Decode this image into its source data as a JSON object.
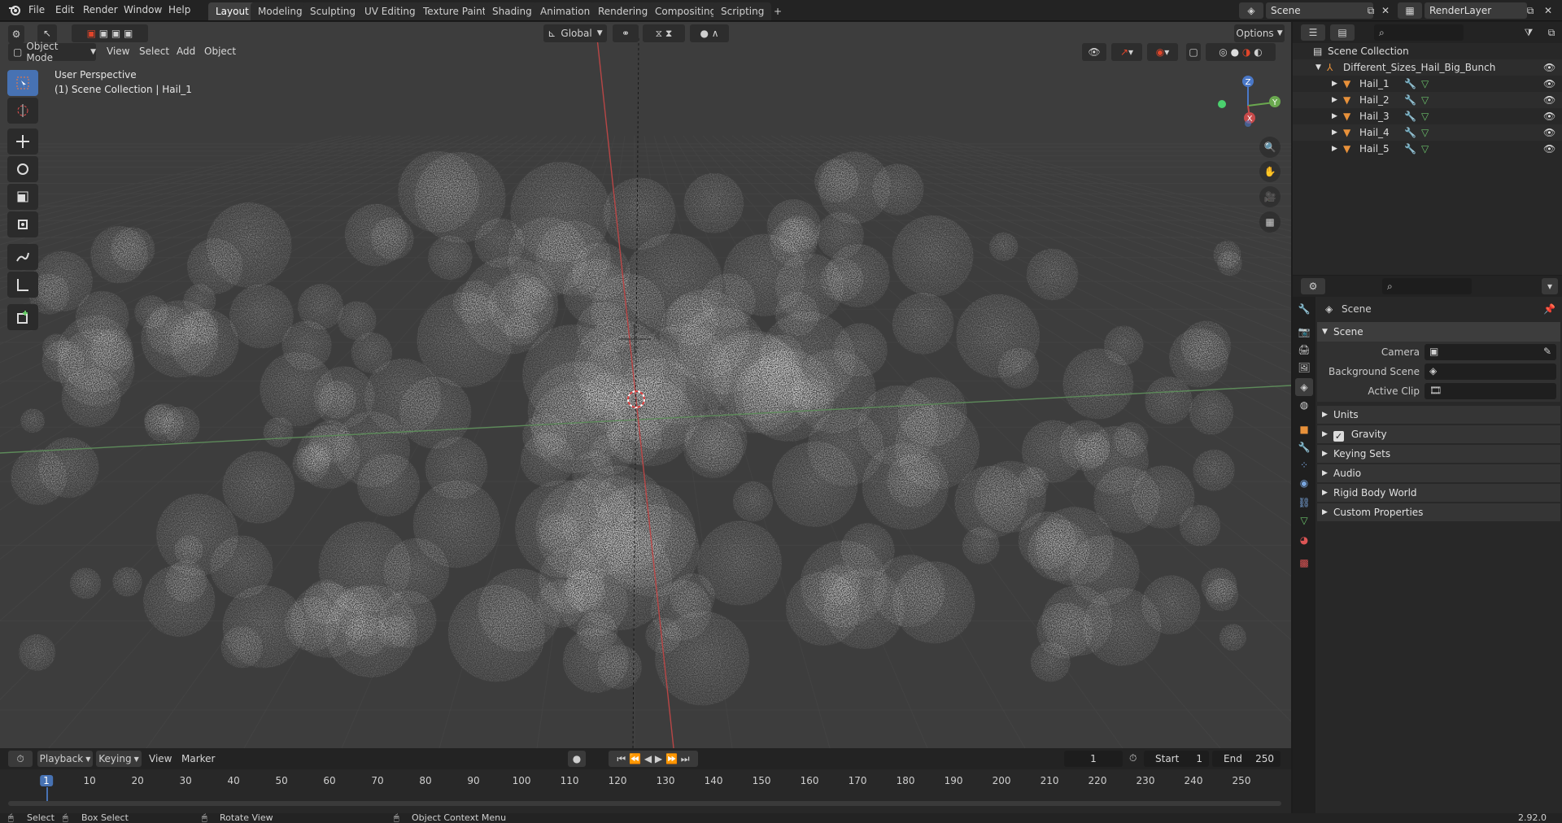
{
  "topbar": {
    "menus": [
      "File",
      "Edit",
      "Render",
      "Window",
      "Help"
    ],
    "workspaces": [
      "Layout",
      "Modeling",
      "Sculpting",
      "UV Editing",
      "Texture Paint",
      "Shading",
      "Animation",
      "Rendering",
      "Compositing",
      "Scripting"
    ],
    "active_workspace": "Layout",
    "add_workspace": "+",
    "scene_name": "Scene",
    "view_layer": "RenderLayer"
  },
  "viewport": {
    "mode": "Object Mode",
    "menus": [
      "View",
      "Select",
      "Add",
      "Object"
    ],
    "transform_orientation": "Global",
    "options_label": "Options",
    "overlay_line1": "User Perspective",
    "overlay_line2": "(1) Scene Collection | Hail_1",
    "gizmo_axes": {
      "z": "Z",
      "y": "Y",
      "x": "X"
    }
  },
  "outliner": {
    "root": "Scene Collection",
    "collection": "Different_Sizes_Hail_Big_Bunch",
    "objects": [
      "Hail_1",
      "Hail_2",
      "Hail_3",
      "Hail_4",
      "Hail_5"
    ]
  },
  "properties": {
    "context_title": "Scene",
    "panel_scene": "Scene",
    "camera_label": "Camera",
    "background_scene_label": "Background Scene",
    "active_clip_label": "Active Clip",
    "collapsed_panels": [
      "Units",
      "Gravity",
      "Keying Sets",
      "Audio",
      "Rigid Body World",
      "Custom Properties"
    ],
    "gravity_checked": true
  },
  "timeline": {
    "menus": [
      "Playback",
      "Keying",
      "View",
      "Marker"
    ],
    "current_frame": "1",
    "start_label": "Start",
    "start_value": "1",
    "end_label": "End",
    "end_value": "250",
    "ticks": [
      "1",
      "10",
      "20",
      "30",
      "40",
      "50",
      "60",
      "70",
      "80",
      "90",
      "100",
      "110",
      "120",
      "130",
      "140",
      "150",
      "160",
      "170",
      "180",
      "190",
      "200",
      "210",
      "220",
      "230",
      "240",
      "250"
    ]
  },
  "statusbar": {
    "select": "Select",
    "box_select": "Box Select",
    "rotate_view": "Rotate View",
    "context_menu": "Object Context Menu",
    "version": "2.92.0"
  },
  "colors": {
    "accent": "#4772b3",
    "x_axis": "#c84a4a",
    "y_axis": "#6aa84f",
    "z_axis": "#4a78c8",
    "object_orange": "#e8913a"
  }
}
